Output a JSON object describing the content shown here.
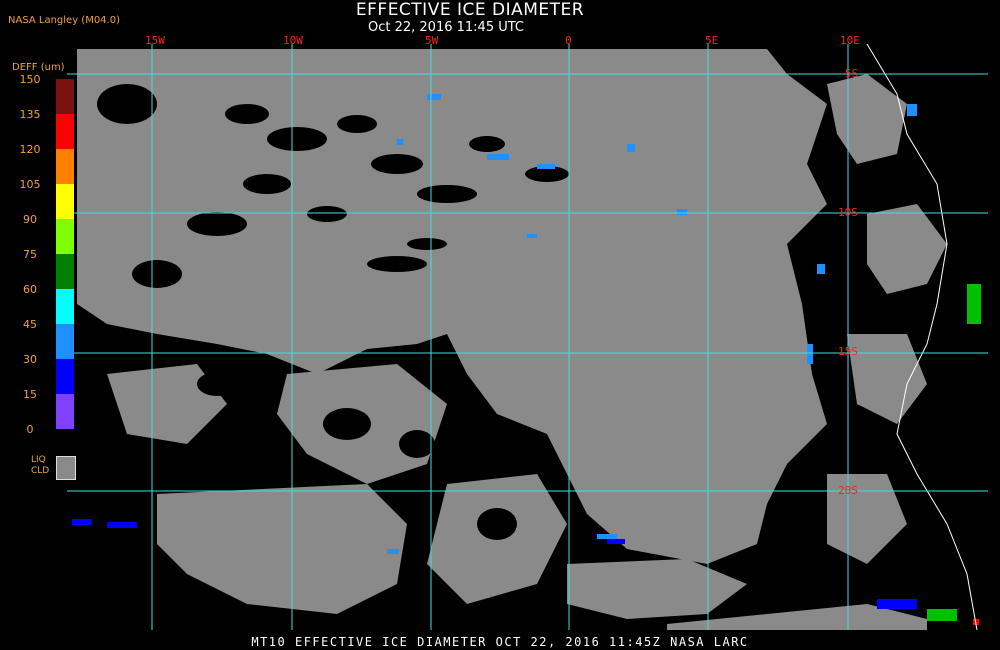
{
  "header": {
    "title": "EFFECTIVE ICE DIAMETER",
    "subtitle": "Oct 22, 2016 11:45 UTC",
    "producer": "NASA Langley (M04.0)"
  },
  "grid": {
    "longitudes": [
      "15W",
      "10W",
      "5W",
      "0",
      "5E",
      "10E"
    ],
    "latitudes": [
      "5S",
      "10S",
      "15S",
      "20S"
    ]
  },
  "legend": {
    "title": "DEFF (um)",
    "ticks": [
      "150",
      "135",
      "120",
      "105",
      "90",
      "75",
      "60",
      "45",
      "30",
      "15",
      "0"
    ],
    "colors": [
      "#7a1010",
      "#ff0000",
      "#ff8000",
      "#ffff00",
      "#80ff00",
      "#008000",
      "#00ffff",
      "#1e90ff",
      "#0000ff",
      "#8040ff"
    ],
    "liq_label_1": "LIQ",
    "liq_label_2": "CLD",
    "liq_color": "#8a8a8a"
  },
  "footer": "MT10  EFFECTIVE ICE DIAMETER  OCT 22, 2016 11:45Z  NASA LARC"
}
